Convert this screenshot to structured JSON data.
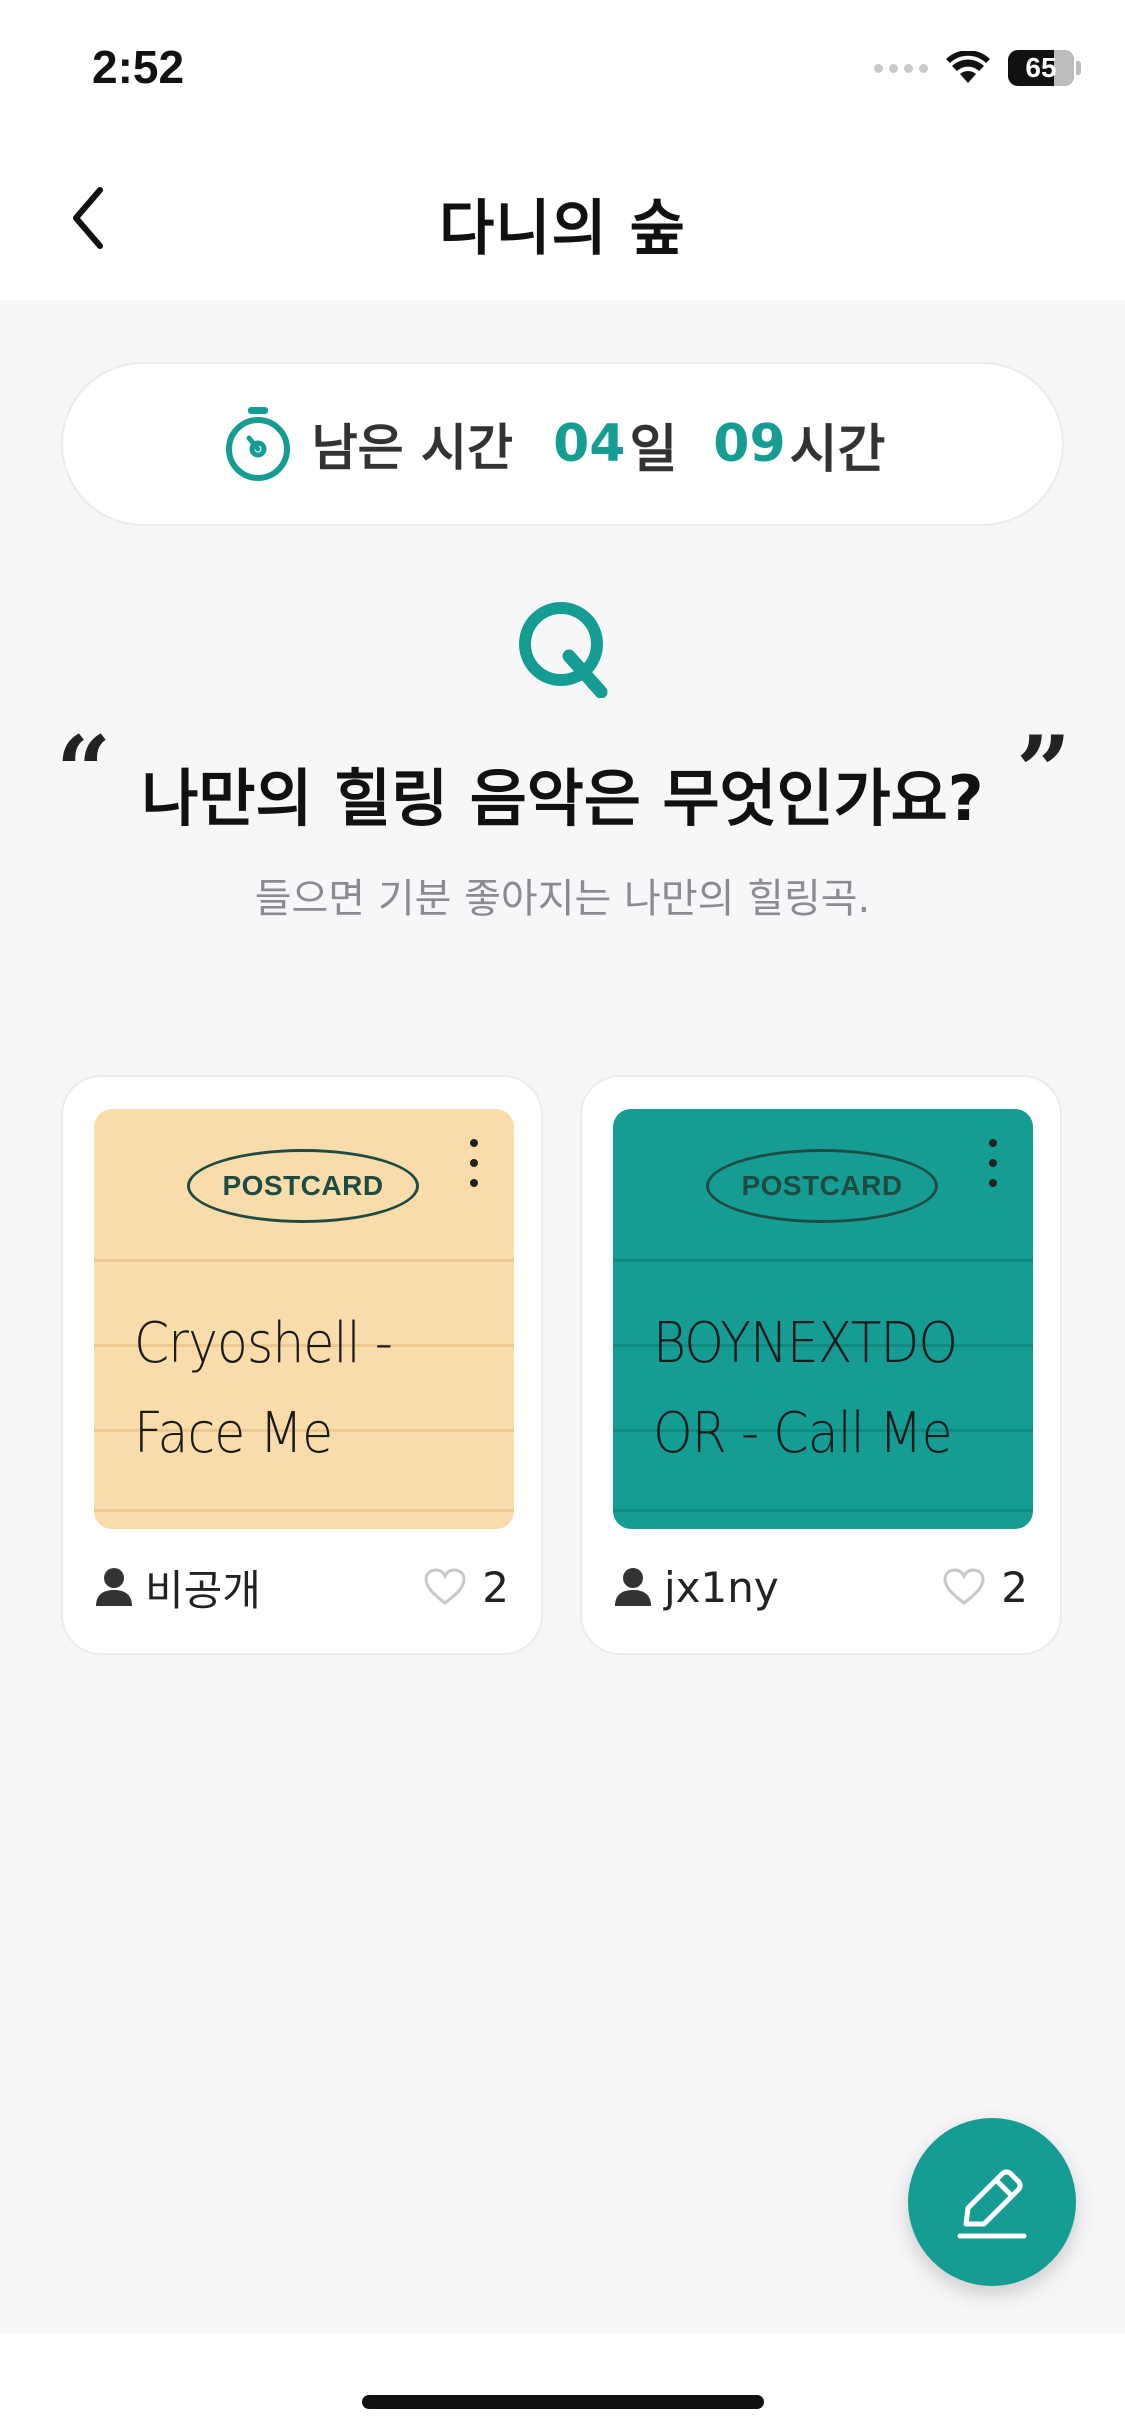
{
  "status_bar": {
    "time": "2:52",
    "battery_level": "65"
  },
  "header": {
    "title": "다니의 숲",
    "back_icon": "chevron-left-icon"
  },
  "timer": {
    "icon": "stopwatch-icon",
    "label": "남은 시간",
    "days_value": "04",
    "days_unit": "일",
    "hours_value": "09",
    "hours_unit": "시간"
  },
  "question": {
    "q_icon": "q-letter-icon",
    "open_quote": "“",
    "close_quote": "”",
    "text": "나만의 힐링 음악은 무엇인가요?",
    "subtitle": "들으면 기분 좋아지는 나만의 힐링곡."
  },
  "cards": [
    {
      "badge": "POSTCARD",
      "lines": [
        "Cryoshell -",
        "Face Me"
      ],
      "author": "비공개",
      "likes": "2",
      "color": "#f8dcaa",
      "line_color": "#ecc992"
    },
    {
      "badge": "POSTCARD",
      "lines": [
        "BOYNEXTDO",
        "OR - Call Me"
      ],
      "author": "jx1ny",
      "likes": "2",
      "color": "#159d94",
      "line_color": "#118a81"
    }
  ],
  "fab": {
    "icon": "pencil-icon"
  },
  "colors": {
    "accent": "#159d94",
    "background": "#f7f7f9"
  }
}
